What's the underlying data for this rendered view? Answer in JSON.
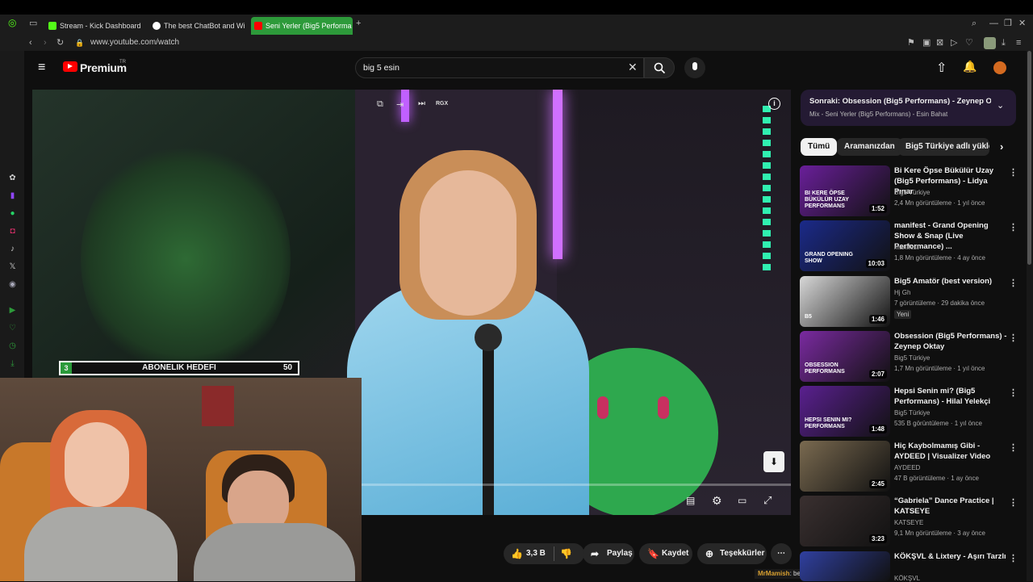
{
  "browser": {
    "tabs": [
      {
        "label": "Stream - Kick Dashboard",
        "color": "#53fc18"
      },
      {
        "label": "The best ChatBot and Wi",
        "color": "#ffffff"
      },
      {
        "label": "Seni Yerler (Big5 Performa",
        "color": "#ff0000"
      }
    ],
    "new_tab": "+",
    "url": "www.youtube.com/watch"
  },
  "youtube": {
    "logo": "Premium",
    "region": "TR",
    "search_query": "big 5 esin"
  },
  "video": {
    "overlay_label": "RGX"
  },
  "goal": {
    "current": "3",
    "label": "ABONELIK HEDEFI",
    "target": "50"
  },
  "actions": {
    "likes": "3,3 B",
    "share": "Paylaş",
    "save": "Kaydet",
    "thanks": "Teşekkürler"
  },
  "chat": {
    "user": "MrMamish",
    "message": ": ben sevmiyorum"
  },
  "up_next": {
    "title": "Sonraki: Obsession (Big5 Performans) - Zeynep Okt...",
    "subtitle": "Mix - Seni Yerler (Big5 Performans) - Esin Bahat"
  },
  "chips": [
    "Tümü",
    "Aramanızdan",
    "Big5 Türkiye adlı yükley"
  ],
  "related": [
    {
      "title": "Bi Kere Öpse Bükülür Uzay (Big5 Performans) - Lidya Pınar",
      "channel": "Big5 Türkiye",
      "meta": "2,4 Mn görüntüleme · 1 yıl önce",
      "duration": "1:52",
      "color": "#6a1f9a",
      "thumb_text": "BI KERE ÖPSE BÜKÜLÜR UZAY PERFORMANS"
    },
    {
      "title": "manifest - Grand Opening Show & Snap (Live Performance) ...",
      "channel": "manifest",
      "meta": "1,8 Mn görüntüleme · 4 ay önce",
      "duration": "10:03",
      "color": "#1b2a8a",
      "thumb_text": "GRAND OPENING SHOW"
    },
    {
      "title": "Big5 Amatör (best version)",
      "channel": "Hj Gh",
      "meta": "7 görüntüleme · 29 dakika önce",
      "badge": "Yeni",
      "duration": "1:46",
      "color": "#d8d8d8",
      "thumb_text": "B5"
    },
    {
      "title": "Obsession (Big5 Performans) - Zeynep Oktay",
      "channel": "Big5 Türkiye",
      "meta": "1,7 Mn görüntüleme · 1 yıl önce",
      "duration": "2:07",
      "color": "#7a2aa0",
      "thumb_text": "OBSESSION PERFORMANS"
    },
    {
      "title": "Hepsi Senin mi? (Big5 Performans) - Hilal Yelekçi",
      "channel": "Big5 Türkiye",
      "meta": "535 B görüntüleme · 1 yıl önce",
      "duration": "1:48",
      "color": "#5a2090",
      "thumb_text": "HEPSI SENIN MI? PERFORMANS"
    },
    {
      "title": "Hiç Kaybolmamış Gibi - AYDEED | Visualizer Video",
      "channel": "AYDEED",
      "meta": "47 B görüntüleme · 1 ay önce",
      "duration": "2:45",
      "color": "#7a6a50",
      "thumb_text": ""
    },
    {
      "title": "“Gabriela” Dance Practice | KATSEYE",
      "channel": "KATSEYE",
      "meta": "9,1 Mn görüntüleme · 3 ay önce",
      "duration": "3:23",
      "color": "#3a3030",
      "thumb_text": ""
    },
    {
      "title": "KÖKŞVL & Lixtery - Aşırı Tarzlı",
      "channel": "KÖKŞVL",
      "meta": "",
      "duration": "",
      "color": "#3040a0",
      "thumb_text": ""
    }
  ]
}
